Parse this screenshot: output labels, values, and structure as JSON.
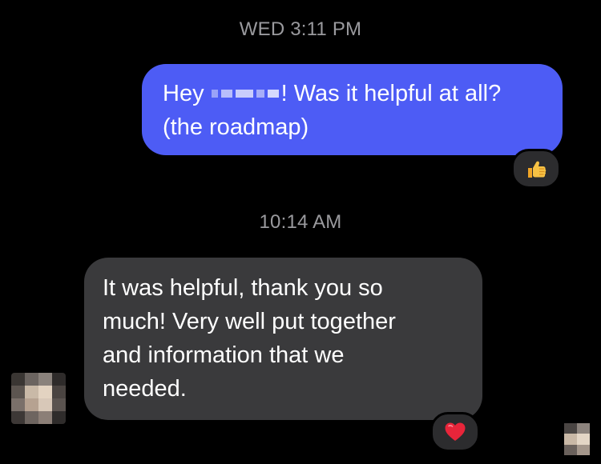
{
  "conversation": {
    "timestamp_1": "WED 3:11 PM",
    "timestamp_2": "10:14 AM"
  },
  "sent_message": {
    "prefix": "Hey ",
    "suffix": "! Was it helpful at all?",
    "line_2": "(the roadmap)",
    "bubble_color": "#4d5cf5"
  },
  "received_message": {
    "line_1": "It was helpful, thank you so",
    "line_2": "much! Very well put together",
    "line_3": "and information that we",
    "line_4": "needed.",
    "bubble_color": "#3a3a3c"
  },
  "reactions": {
    "sent": "thumbs-up",
    "received": "red-heart"
  },
  "icons": {
    "thumbs_up": "thumbs-up-icon",
    "heart": "heart-icon",
    "avatar": "avatar-blurred",
    "read_receipt": "read-receipt-avatar"
  },
  "colors": {
    "background": "#000000",
    "timestamp": "#9a9a9e",
    "reaction_bg": "#2c2c2e",
    "heart": "#e8253a",
    "thumb": "#f4b73b"
  }
}
